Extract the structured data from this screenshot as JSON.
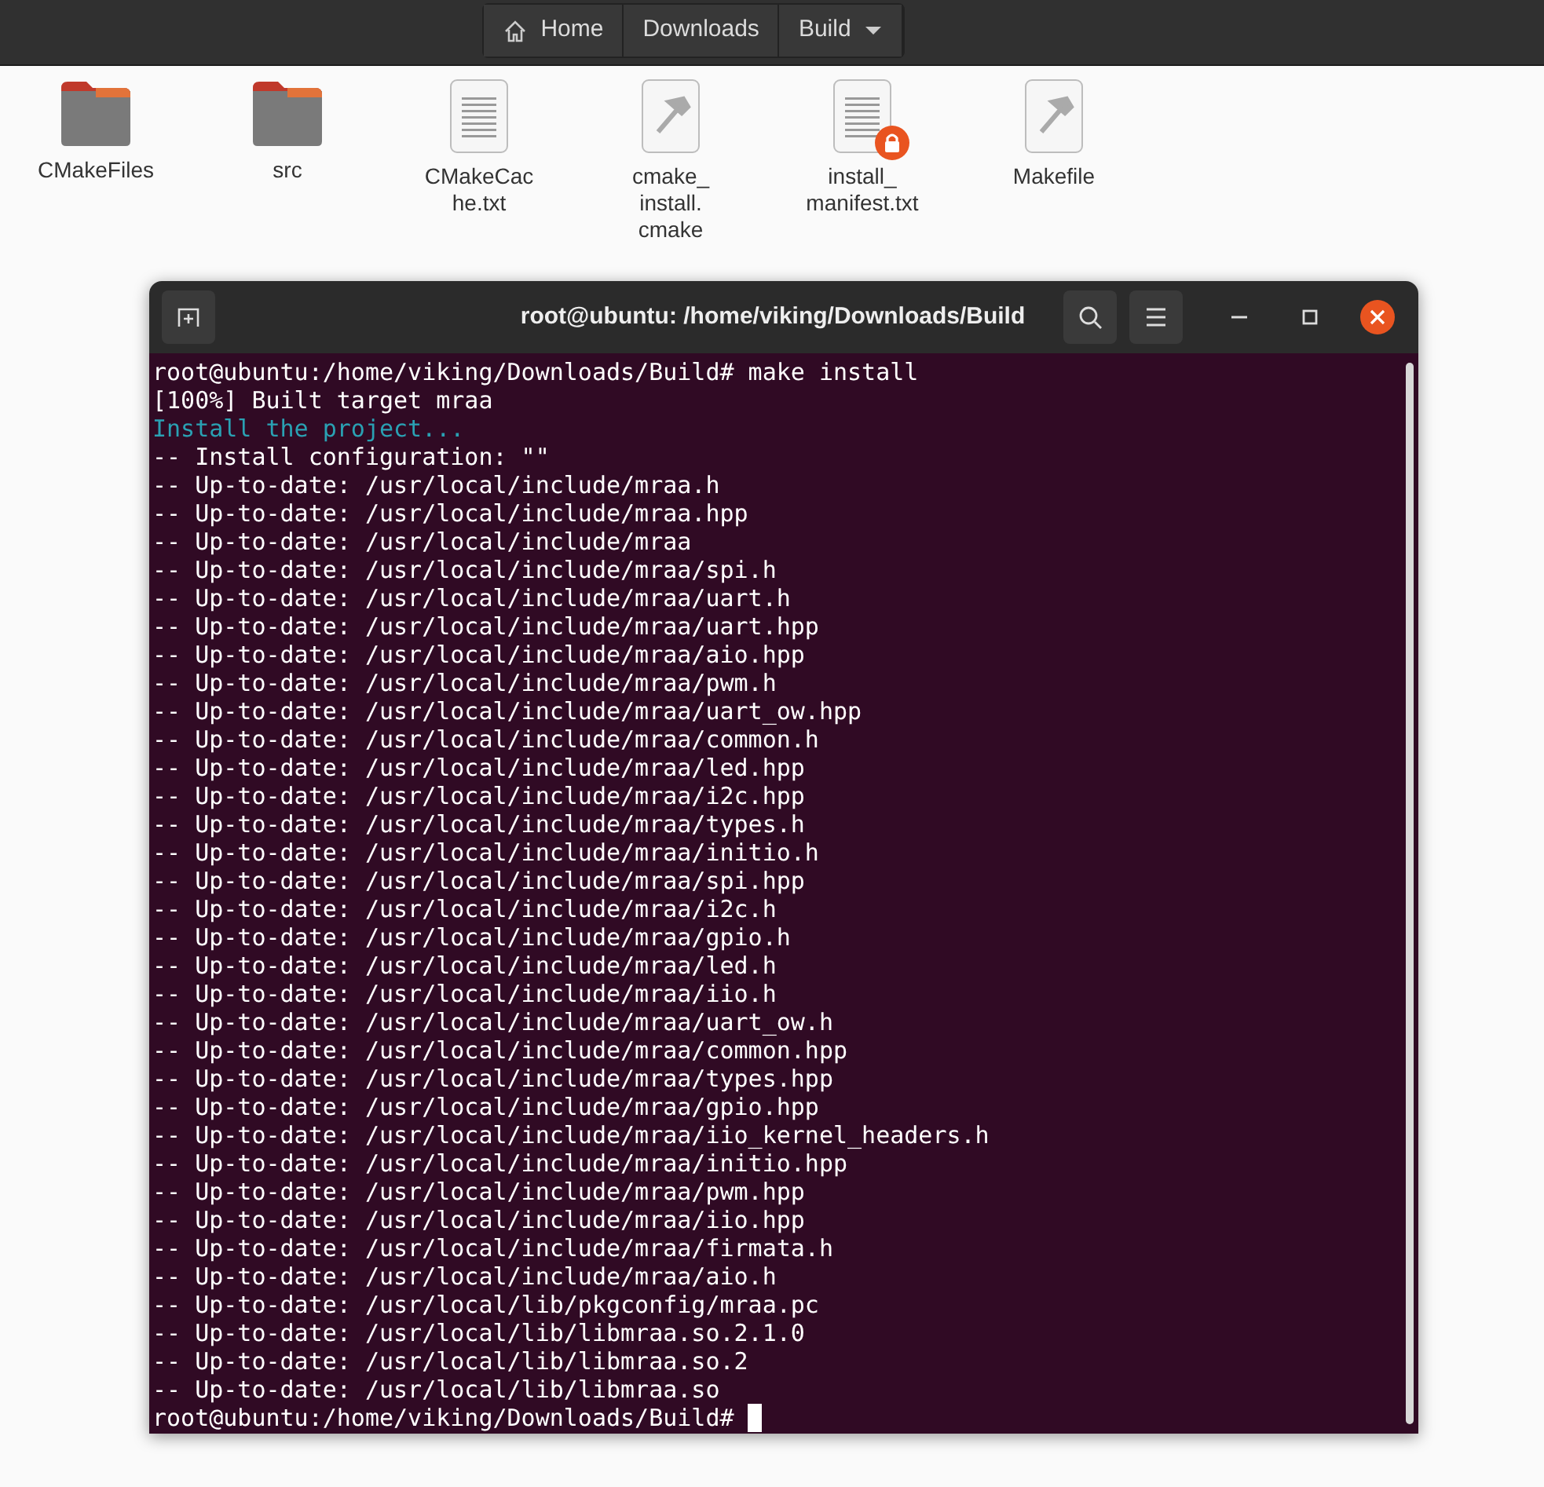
{
  "path_bar": {
    "segments": [
      {
        "label": "Home",
        "kind": "home"
      },
      {
        "label": "Downloads",
        "kind": "plain"
      },
      {
        "label": "Build",
        "kind": "dropdown"
      }
    ]
  },
  "files": [
    {
      "name": "CMakeFiles",
      "kind": "folder",
      "locked": false
    },
    {
      "name": "src",
      "kind": "folder",
      "locked": false
    },
    {
      "name": "CMakeCache.txt",
      "kind": "text",
      "locked": false
    },
    {
      "name": "cmake_install.cmake",
      "kind": "script",
      "locked": false
    },
    {
      "name": "install_manifest.txt",
      "kind": "text",
      "locked": true
    },
    {
      "name": "Makefile",
      "kind": "script",
      "locked": false
    }
  ],
  "terminal": {
    "title": "root@ubuntu: /home/viking/Downloads/Build",
    "lines": [
      {
        "kind": "command",
        "text": "root@ubuntu:/home/viking/Downloads/Build# make install"
      },
      {
        "kind": "output",
        "text": "[100%] Built target mraa"
      },
      {
        "kind": "info",
        "text": "Install the project..."
      },
      {
        "kind": "output",
        "text": "-- Install configuration: \"\""
      },
      {
        "kind": "output",
        "text": "-- Up-to-date: /usr/local/include/mraa.h"
      },
      {
        "kind": "output",
        "text": "-- Up-to-date: /usr/local/include/mraa.hpp"
      },
      {
        "kind": "output",
        "text": "-- Up-to-date: /usr/local/include/mraa"
      },
      {
        "kind": "output",
        "text": "-- Up-to-date: /usr/local/include/mraa/spi.h"
      },
      {
        "kind": "output",
        "text": "-- Up-to-date: /usr/local/include/mraa/uart.h"
      },
      {
        "kind": "output",
        "text": "-- Up-to-date: /usr/local/include/mraa/uart.hpp"
      },
      {
        "kind": "output",
        "text": "-- Up-to-date: /usr/local/include/mraa/aio.hpp"
      },
      {
        "kind": "output",
        "text": "-- Up-to-date: /usr/local/include/mraa/pwm.h"
      },
      {
        "kind": "output",
        "text": "-- Up-to-date: /usr/local/include/mraa/uart_ow.hpp"
      },
      {
        "kind": "output",
        "text": "-- Up-to-date: /usr/local/include/mraa/common.h"
      },
      {
        "kind": "output",
        "text": "-- Up-to-date: /usr/local/include/mraa/led.hpp"
      },
      {
        "kind": "output",
        "text": "-- Up-to-date: /usr/local/include/mraa/i2c.hpp"
      },
      {
        "kind": "output",
        "text": "-- Up-to-date: /usr/local/include/mraa/types.h"
      },
      {
        "kind": "output",
        "text": "-- Up-to-date: /usr/local/include/mraa/initio.h"
      },
      {
        "kind": "output",
        "text": "-- Up-to-date: /usr/local/include/mraa/spi.hpp"
      },
      {
        "kind": "output",
        "text": "-- Up-to-date: /usr/local/include/mraa/i2c.h"
      },
      {
        "kind": "output",
        "text": "-- Up-to-date: /usr/local/include/mraa/gpio.h"
      },
      {
        "kind": "output",
        "text": "-- Up-to-date: /usr/local/include/mraa/led.h"
      },
      {
        "kind": "output",
        "text": "-- Up-to-date: /usr/local/include/mraa/iio.h"
      },
      {
        "kind": "output",
        "text": "-- Up-to-date: /usr/local/include/mraa/uart_ow.h"
      },
      {
        "kind": "output",
        "text": "-- Up-to-date: /usr/local/include/mraa/common.hpp"
      },
      {
        "kind": "output",
        "text": "-- Up-to-date: /usr/local/include/mraa/types.hpp"
      },
      {
        "kind": "output",
        "text": "-- Up-to-date: /usr/local/include/mraa/gpio.hpp"
      },
      {
        "kind": "output",
        "text": "-- Up-to-date: /usr/local/include/mraa/iio_kernel_headers.h"
      },
      {
        "kind": "output",
        "text": "-- Up-to-date: /usr/local/include/mraa/initio.hpp"
      },
      {
        "kind": "output",
        "text": "-- Up-to-date: /usr/local/include/mraa/pwm.hpp"
      },
      {
        "kind": "output",
        "text": "-- Up-to-date: /usr/local/include/mraa/iio.hpp"
      },
      {
        "kind": "output",
        "text": "-- Up-to-date: /usr/local/include/mraa/firmata.h"
      },
      {
        "kind": "output",
        "text": "-- Up-to-date: /usr/local/include/mraa/aio.h"
      },
      {
        "kind": "output",
        "text": "-- Up-to-date: /usr/local/lib/pkgconfig/mraa.pc"
      },
      {
        "kind": "output",
        "text": "-- Up-to-date: /usr/local/lib/libmraa.so.2.1.0"
      },
      {
        "kind": "output",
        "text": "-- Up-to-date: /usr/local/lib/libmraa.so.2"
      },
      {
        "kind": "output",
        "text": "-- Up-to-date: /usr/local/lib/libmraa.so"
      }
    ],
    "prompt": "root@ubuntu:/home/viking/Downloads/Build#"
  }
}
